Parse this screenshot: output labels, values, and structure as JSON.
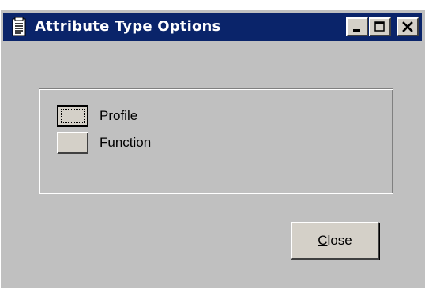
{
  "window": {
    "title": "Attribute Type Options",
    "icon": "document-icon",
    "controls": {
      "minimize_icon": "minimize-icon",
      "maximize_icon": "maximize-icon",
      "close_icon": "close-icon"
    },
    "titlebar_color": "#0a246a",
    "face_color": "#c0c0c0"
  },
  "options": [
    {
      "label": "Profile",
      "focused": true
    },
    {
      "label": "Function",
      "focused": false
    }
  ],
  "close_button": {
    "mnemonic": "C",
    "rest": "lose"
  }
}
